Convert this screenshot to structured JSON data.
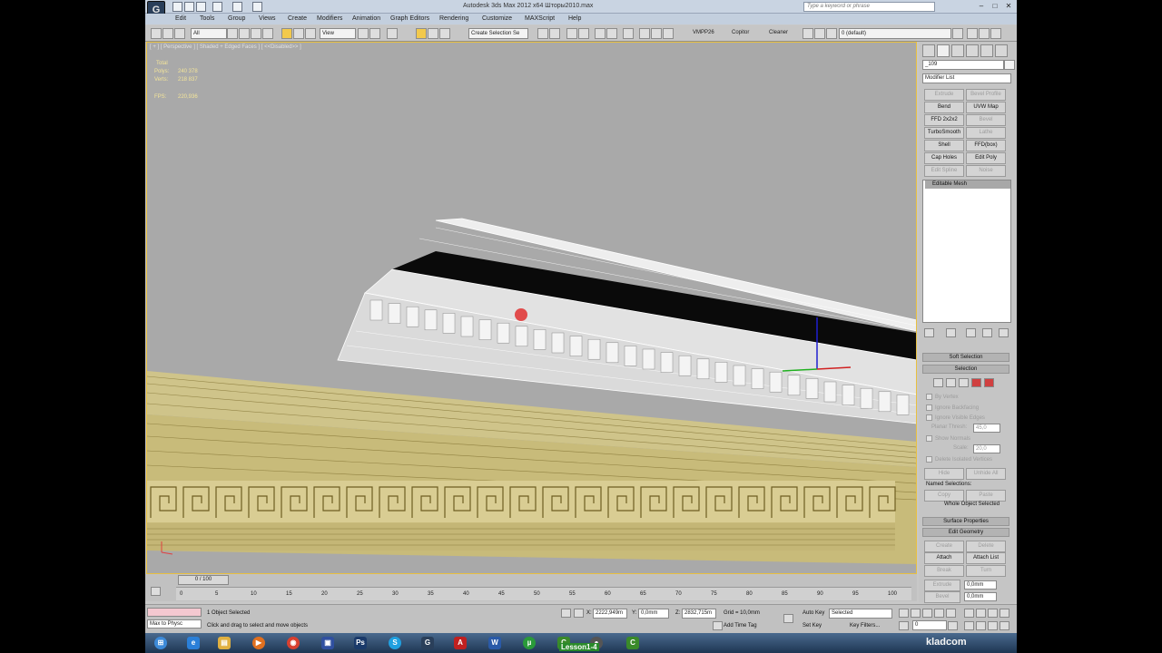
{
  "window": {
    "title": "Autodesk 3ds Max  2012 x64      Шторы2010.max",
    "search_placeholder": "Type a keyword or phrase",
    "min": "–",
    "max": "□",
    "close": "✕"
  },
  "menu": [
    "Edit",
    "Tools",
    "Group",
    "Views",
    "Create",
    "Modifiers",
    "Animation",
    "Graph Editors",
    "Rendering",
    "Customize",
    "MAXScript",
    "Help"
  ],
  "toolbar": {
    "filter": "All",
    "view": "View",
    "selection_set": "Create Selection Se",
    "labels": [
      "VMPP26",
      "Copitor",
      "Cleaner"
    ],
    "layer": "0 (default)"
  },
  "viewport": {
    "label": "[ + ] [ Perspective ] [ Shaded + Edged Faces ] [ <<Disabled>> ]",
    "stats": {
      "total": "Total",
      "polys_label": "Polys:",
      "polys": "240 378",
      "verts_label": "Verts:",
      "verts": "218 837",
      "fps_label": "FPS:",
      "fps": "220,936"
    }
  },
  "command_panel": {
    "object_name": "_109",
    "modifier_list": "Modifier List",
    "modifier_buttons": [
      {
        "label": "Extrude",
        "enabled": false
      },
      {
        "label": "Bevel Profile",
        "enabled": false
      },
      {
        "label": "Bend",
        "enabled": true
      },
      {
        "label": "UVW Map",
        "enabled": true
      },
      {
        "label": "FFD 2x2x2",
        "enabled": true
      },
      {
        "label": "Bevel",
        "enabled": false
      },
      {
        "label": "TurboSmooth",
        "enabled": true
      },
      {
        "label": "Lathe",
        "enabled": false
      },
      {
        "label": "Shell",
        "enabled": true
      },
      {
        "label": "FFD(box)",
        "enabled": true
      },
      {
        "label": "Cap Holes",
        "enabled": true
      },
      {
        "label": "Edit Poly",
        "enabled": true
      },
      {
        "label": "Edit Spline",
        "enabled": false
      },
      {
        "label": "Noise",
        "enabled": false
      }
    ],
    "stack_item": "Editable Mesh",
    "rollouts": {
      "soft_selection": "Soft Selection",
      "selection": "Selection",
      "surface_properties": "Surface Properties",
      "edit_geometry": "Edit Geometry"
    },
    "selection": {
      "by_vertex": "By Vertex",
      "ignore_backfacing": "Ignore Backfacing",
      "ignore_visible_edges": "Ignore Visible Edges",
      "planar_thresh": "Planar Thresh:",
      "planar_value": "45,0",
      "show_normals": "Show Normals",
      "scale": "Scale:",
      "scale_value": "20,0",
      "delete_isolated": "Delete Isolated Vertices",
      "hide": "Hide",
      "unhide_all": "Unhide All",
      "named_selections": "Named Selections:",
      "copy": "Copy",
      "paste": "Paste",
      "whole_object": "Whole Object Selected"
    },
    "edit_geometry": {
      "create": "Create",
      "delete": "Delete",
      "attach": "Attach",
      "attach_list": "Attach List",
      "break": "Break",
      "turn": "Turn",
      "extrude": "Extrude",
      "extrude_value": "0,0mm",
      "bevel": "Bevel",
      "bevel_value": "0,0mm"
    }
  },
  "timeline": {
    "frame": "0 / 100",
    "ticks": [
      "0",
      "5",
      "10",
      "15",
      "20",
      "25",
      "30",
      "35",
      "40",
      "45",
      "50",
      "55",
      "60",
      "65",
      "70",
      "75",
      "80",
      "85",
      "90",
      "95",
      "100"
    ]
  },
  "status": {
    "maxscript": "Max to Physc",
    "selected": "1 Object Selected",
    "prompt": "Click and drag to select and move objects",
    "x_label": "X:",
    "x": "2222,949m",
    "y_label": "Y:",
    "y": "0,0mm",
    "z_label": "Z:",
    "z": "2832,715m",
    "grid": "Grid = 10,0mm",
    "add_time_tag": "Add Time Tag",
    "auto_key": "Auto Key",
    "set_key": "Set Key",
    "key_mode": "Selected",
    "key_filters": "Key Filters...",
    "current_frame": "0"
  },
  "taskbar": {
    "lesson": "Lesson1-4",
    "watermark": "kladcom"
  },
  "colors": {
    "viewport_bg": "#a9a9a9",
    "gold": "#d6c88a",
    "accent": "#f2c94c",
    "taskbar": "#2a4666"
  }
}
